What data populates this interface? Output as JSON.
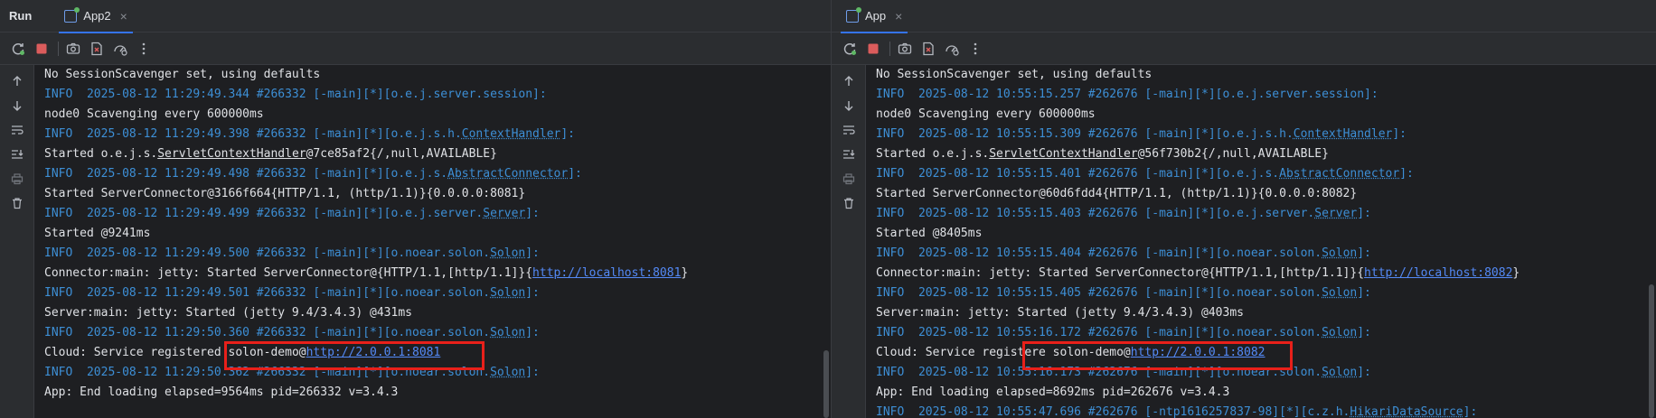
{
  "run_label": "Run",
  "colors": {
    "info": "#3d8fd6",
    "link": "#548af7",
    "highlight": "#e8201a",
    "accent": "#3574f0"
  },
  "toolbar_icons": [
    "rerun-icon",
    "stop-icon",
    "camera-icon",
    "dump-icon",
    "profiler-icon",
    "more-icon"
  ],
  "side_icons": [
    "arrow-up-icon",
    "arrow-down-icon",
    "soft-wrap-icon",
    "scroll-to-end-icon",
    "print-icon",
    "trash-icon"
  ],
  "left": {
    "tab": {
      "label": "App2",
      "close": "×"
    },
    "lines": [
      {
        "kind": "out",
        "segs": [
          {
            "t": "No SessionScavenger set, using defaults"
          }
        ]
      },
      {
        "kind": "info",
        "segs": [
          {
            "t": "INFO  2025-08-12 11:29:49.344 #266332 [-main][*][o.e.j.server.session]:"
          }
        ]
      },
      {
        "kind": "out",
        "segs": [
          {
            "t": "node0 Scavenging every 600000ms"
          }
        ]
      },
      {
        "kind": "info",
        "segs": [
          {
            "t": "INFO  2025-08-12 11:29:49.398 #266332 [-main][*][o.e.j.s.h."
          },
          {
            "t": "ContextHandler",
            "s": "ul"
          },
          {
            "t": "]:"
          }
        ]
      },
      {
        "kind": "out",
        "segs": [
          {
            "t": "Started o.e.j.s."
          },
          {
            "t": "ServletContextHandler",
            "s": "ul"
          },
          {
            "t": "@7ce85af2{/,null,AVAILABLE}"
          }
        ]
      },
      {
        "kind": "info",
        "segs": [
          {
            "t": "INFO  2025-08-12 11:29:49.498 #266332 [-main][*][o.e.j.s."
          },
          {
            "t": "AbstractConnector",
            "s": "ul"
          },
          {
            "t": "]:"
          }
        ]
      },
      {
        "kind": "out",
        "segs": [
          {
            "t": "Started ServerConnector@3166f664{HTTP/1.1, (http/1.1)}{0.0.0.0:8081}"
          }
        ]
      },
      {
        "kind": "info",
        "segs": [
          {
            "t": "INFO  2025-08-12 11:29:49.499 #266332 [-main][*][o.e.j.server."
          },
          {
            "t": "Server",
            "s": "ul"
          },
          {
            "t": "]:"
          }
        ]
      },
      {
        "kind": "out",
        "segs": [
          {
            "t": "Started @9241ms"
          }
        ]
      },
      {
        "kind": "info",
        "segs": [
          {
            "t": "INFO  2025-08-12 11:29:49.500 #266332 [-main][*][o.noear.solon."
          },
          {
            "t": "Solon",
            "s": "ul"
          },
          {
            "t": "]:"
          }
        ]
      },
      {
        "kind": "out",
        "segs": [
          {
            "t": "Connector:main: jetty: Started ServerConnector@{HTTP/1.1,[http/1.1]}{"
          },
          {
            "t": "http://localhost:8081",
            "s": "link"
          },
          {
            "t": "}"
          }
        ]
      },
      {
        "kind": "info",
        "segs": [
          {
            "t": "INFO  2025-08-12 11:29:49.501 #266332 [-main][*][o.noear.solon."
          },
          {
            "t": "Solon",
            "s": "ul"
          },
          {
            "t": "]:"
          }
        ]
      },
      {
        "kind": "out",
        "segs": [
          {
            "t": "Server:main: jetty: Started (jetty 9.4/3.4.3) @431ms"
          }
        ]
      },
      {
        "kind": "info",
        "segs": [
          {
            "t": "INFO  2025-08-12 11:29:50.360 #266332 [-main][*][o.noear.solon."
          },
          {
            "t": "Solon",
            "s": "ul"
          },
          {
            "t": "]:"
          }
        ]
      },
      {
        "kind": "out",
        "segs": [
          {
            "t": "Cloud: Service registered "
          },
          {
            "t": "solon-demo@"
          },
          {
            "t": "http://2.0.0.1:8081",
            "s": "link"
          }
        ]
      },
      {
        "kind": "info",
        "segs": [
          {
            "t": "INFO  2025-08-12 11:29:50.362 #266332 [-main][*][o.noear.solon."
          },
          {
            "t": "Solon",
            "s": "ul"
          },
          {
            "t": "]:"
          }
        ]
      },
      {
        "kind": "out",
        "segs": [
          {
            "t": "App: End loading elapsed=9564ms pid=266332 v=3.4.3"
          }
        ]
      }
    ]
  },
  "right": {
    "tab": {
      "label": "App",
      "close": "×"
    },
    "lines": [
      {
        "kind": "out",
        "segs": [
          {
            "t": "No SessionScavenger set, using defaults"
          }
        ]
      },
      {
        "kind": "info",
        "segs": [
          {
            "t": "INFO  2025-08-12 10:55:15.257 #262676 [-main][*][o.e.j.server.session]:"
          }
        ]
      },
      {
        "kind": "out",
        "segs": [
          {
            "t": "node0 Scavenging every 600000ms"
          }
        ]
      },
      {
        "kind": "info",
        "segs": [
          {
            "t": "INFO  2025-08-12 10:55:15.309 #262676 [-main][*][o.e.j.s.h."
          },
          {
            "t": "ContextHandler",
            "s": "ul"
          },
          {
            "t": "]:"
          }
        ]
      },
      {
        "kind": "out",
        "segs": [
          {
            "t": "Started o.e.j.s."
          },
          {
            "t": "ServletContextHandler",
            "s": "ul"
          },
          {
            "t": "@56f730b2{/,null,AVAILABLE}"
          }
        ]
      },
      {
        "kind": "info",
        "segs": [
          {
            "t": "INFO  2025-08-12 10:55:15.401 #262676 [-main][*][o.e.j.s."
          },
          {
            "t": "AbstractConnector",
            "s": "ul"
          },
          {
            "t": "]:"
          }
        ]
      },
      {
        "kind": "out",
        "segs": [
          {
            "t": "Started ServerConnector@60d6fdd4{HTTP/1.1, (http/1.1)}{0.0.0.0:8082}"
          }
        ]
      },
      {
        "kind": "info",
        "segs": [
          {
            "t": "INFO  2025-08-12 10:55:15.403 #262676 [-main][*][o.e.j.server."
          },
          {
            "t": "Server",
            "s": "ul"
          },
          {
            "t": "]:"
          }
        ]
      },
      {
        "kind": "out",
        "segs": [
          {
            "t": "Started @8405ms"
          }
        ]
      },
      {
        "kind": "info",
        "segs": [
          {
            "t": "INFO  2025-08-12 10:55:15.404 #262676 [-main][*][o.noear.solon."
          },
          {
            "t": "Solon",
            "s": "ul"
          },
          {
            "t": "]:"
          }
        ]
      },
      {
        "kind": "out",
        "segs": [
          {
            "t": "Connector:main: jetty: Started ServerConnector@{HTTP/1.1,[http/1.1]}{"
          },
          {
            "t": "http://localhost:8082",
            "s": "link"
          },
          {
            "t": "}"
          }
        ]
      },
      {
        "kind": "info",
        "segs": [
          {
            "t": "INFO  2025-08-12 10:55:15.405 #262676 [-main][*][o.noear.solon."
          },
          {
            "t": "Solon",
            "s": "ul"
          },
          {
            "t": "]:"
          }
        ]
      },
      {
        "kind": "out",
        "segs": [
          {
            "t": "Server:main: jetty: Started (jetty 9.4/3.4.3) @403ms"
          }
        ]
      },
      {
        "kind": "info",
        "segs": [
          {
            "t": "INFO  2025-08-12 10:55:16.172 #262676 [-main][*][o.noear.solon."
          },
          {
            "t": "Solon",
            "s": "ul"
          },
          {
            "t": "]:"
          }
        ]
      },
      {
        "kind": "out",
        "segs": [
          {
            "t": "Cloud: Service registere"
          },
          {
            "t": " solon-demo@"
          },
          {
            "t": "http://2.0.0.1:8082",
            "s": "link"
          }
        ]
      },
      {
        "kind": "info",
        "segs": [
          {
            "t": "INFO  2025-08-12 10:55:16.173 #262676 [-main][*][o.noear.solon."
          },
          {
            "t": "Solon",
            "s": "ul"
          },
          {
            "t": "]:"
          }
        ]
      },
      {
        "kind": "out",
        "segs": [
          {
            "t": "App: End loading elapsed=8692ms pid=262676 v=3.4.3"
          }
        ]
      },
      {
        "kind": "info",
        "segs": [
          {
            "t": "INFO  2025-08-12 10:55:47.696 #262676 [-ntp1616257837-98][*][c.z.h."
          },
          {
            "t": "HikariDataSource",
            "s": "ul"
          },
          {
            "t": "]:"
          }
        ]
      }
    ]
  }
}
